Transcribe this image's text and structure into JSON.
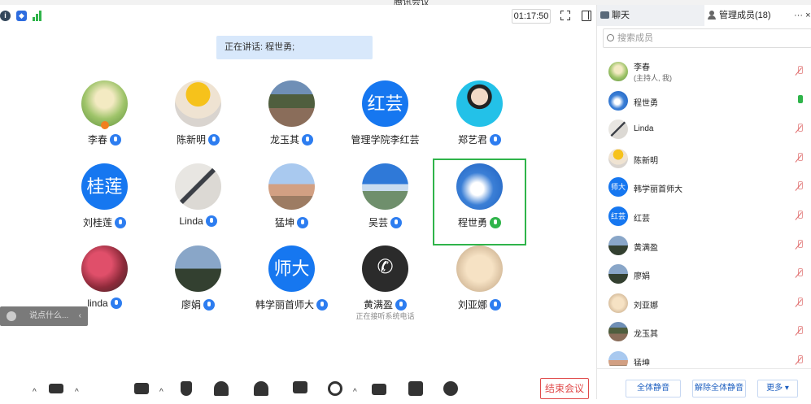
{
  "window": {
    "title": "腾讯会议"
  },
  "topbar": {
    "timer": "01:17:50"
  },
  "speaking": {
    "label": "正在讲话: 程世勇;"
  },
  "participants": [
    {
      "name": "李春",
      "photo": "meadow",
      "mic": "blue"
    },
    {
      "name": "陈新明",
      "photo": "cartoon",
      "mic": "blue"
    },
    {
      "name": "龙玉其",
      "photo": "town",
      "mic": "blue"
    },
    {
      "name": "管理学院李红芸",
      "avatar_text": "红芸",
      "mic": "none"
    },
    {
      "name": "郑艺君",
      "photo": "portrait",
      "mic": "blue"
    },
    {
      "name": "刘桂莲",
      "avatar_text": "桂莲",
      "mic": "blue"
    },
    {
      "name": "Linda",
      "photo": "shadow",
      "mic": "blue"
    },
    {
      "name": "猛坤",
      "photo": "desert",
      "mic": "blue"
    },
    {
      "name": "吴芸",
      "photo": "dome",
      "mic": "blue"
    },
    {
      "name": "程世勇",
      "photo": "sky",
      "mic": "green",
      "active_speaker": true
    },
    {
      "name": "linda",
      "photo": "leaves",
      "mic": "blue"
    },
    {
      "name": "廖娟",
      "photo": "field",
      "mic": "blue"
    },
    {
      "name": "韩学丽首师大",
      "avatar_text": "师大",
      "mic": "blue"
    },
    {
      "name": "黄满盈",
      "photo": "phone",
      "mic": "blue",
      "status": "正在接听系统电话"
    },
    {
      "name": "刘亚娜",
      "photo": "shell",
      "mic": "blue"
    }
  ],
  "chat_input": {
    "placeholder": "说点什么..."
  },
  "end_button": {
    "label": "结束会议"
  },
  "panel": {
    "chat_tab": "聊天",
    "members_tab": "管理成员(18)",
    "more": "···",
    "close": "×",
    "search_placeholder": "搜索成员",
    "members": [
      {
        "name": "李春",
        "sub": "(主持人, 我)",
        "photo": "meadow",
        "muted": true
      },
      {
        "name": "程世勇",
        "photo": "sky",
        "muted": false
      },
      {
        "name": "Linda",
        "photo": "shadow",
        "muted": true
      },
      {
        "name": "陈新明",
        "photo": "cartoon",
        "muted": true
      },
      {
        "name": "韩学丽首师大",
        "avatar_text": "师大",
        "muted": true
      },
      {
        "name": "红芸",
        "avatar_text": "红芸",
        "muted": true
      },
      {
        "name": "黄满盈",
        "photo": "field",
        "muted": true
      },
      {
        "name": "廖娟",
        "photo": "field",
        "muted": true
      },
      {
        "name": "刘亚娜",
        "photo": "shell",
        "muted": true
      },
      {
        "name": "龙玉其",
        "photo": "town",
        "muted": true
      },
      {
        "name": "猛坤",
        "photo": "desert",
        "muted": true
      }
    ],
    "buttons": {
      "mute_all": "全体静音",
      "unmute_all": "解除全体静音",
      "more": "更多 ▾"
    }
  }
}
